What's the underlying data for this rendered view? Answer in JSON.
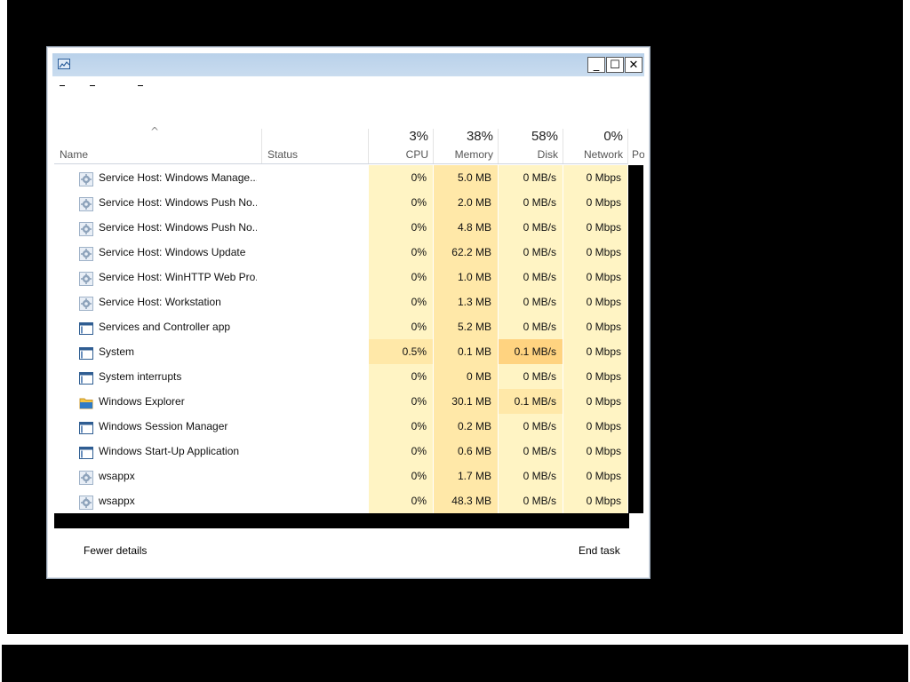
{
  "window": {
    "title": ""
  },
  "header": {
    "name_label": "Name",
    "status_label": "Status",
    "cpu": {
      "percent": "3%",
      "label": "CPU"
    },
    "memory": {
      "percent": "38%",
      "label": "Memory"
    },
    "disk": {
      "percent": "58%",
      "label": "Disk"
    },
    "network": {
      "percent": "0%",
      "label": "Network"
    },
    "power_partial": "Po",
    "sort_indicator": "^"
  },
  "colors": {
    "light_heat": "#fff4c4",
    "medium_heat": "#ffe8a8",
    "high_heat": "#ffd380"
  },
  "rows": [
    {
      "icon": "gear-icon",
      "name": "Service Host: Windows Manage...",
      "status": "",
      "cpu": "0%",
      "memory": "5.0 MB",
      "disk": "0 MB/s",
      "network": "0 Mbps"
    },
    {
      "icon": "gear-icon",
      "name": "Service Host: Windows Push No...",
      "status": "",
      "cpu": "0%",
      "memory": "2.0 MB",
      "disk": "0 MB/s",
      "network": "0 Mbps"
    },
    {
      "icon": "gear-icon",
      "name": "Service Host: Windows Push No...",
      "status": "",
      "cpu": "0%",
      "memory": "4.8 MB",
      "disk": "0 MB/s",
      "network": "0 Mbps"
    },
    {
      "icon": "gear-icon",
      "name": "Service Host: Windows Update",
      "status": "",
      "cpu": "0%",
      "memory": "62.2 MB",
      "disk": "0 MB/s",
      "network": "0 Mbps"
    },
    {
      "icon": "gear-icon",
      "name": "Service Host: WinHTTP Web Pro...",
      "status": "",
      "cpu": "0%",
      "memory": "1.0 MB",
      "disk": "0 MB/s",
      "network": "0 Mbps"
    },
    {
      "icon": "gear-icon",
      "name": "Service Host: Workstation",
      "status": "",
      "cpu": "0%",
      "memory": "1.3 MB",
      "disk": "0 MB/s",
      "network": "0 Mbps"
    },
    {
      "icon": "app-window-icon",
      "name": "Services and Controller app",
      "status": "",
      "cpu": "0%",
      "memory": "5.2 MB",
      "disk": "0 MB/s",
      "network": "0 Mbps"
    },
    {
      "icon": "app-window-icon",
      "name": "System",
      "status": "",
      "cpu": "0.5%",
      "memory": "0.1 MB",
      "disk": "0.1 MB/s",
      "network": "0 Mbps",
      "cpu_heat": "medium",
      "disk_heat": "high"
    },
    {
      "icon": "app-window-icon",
      "name": "System interrupts",
      "status": "",
      "cpu": "0%",
      "memory": "0 MB",
      "disk": "0 MB/s",
      "network": "0 Mbps"
    },
    {
      "icon": "folder-icon",
      "name": "Windows Explorer",
      "status": "",
      "cpu": "0%",
      "memory": "30.1 MB",
      "disk": "0.1 MB/s",
      "network": "0 Mbps",
      "disk_heat": "medium"
    },
    {
      "icon": "app-window-icon",
      "name": "Windows Session Manager",
      "status": "",
      "cpu": "0%",
      "memory": "0.2 MB",
      "disk": "0 MB/s",
      "network": "0 Mbps"
    },
    {
      "icon": "app-window-icon",
      "name": "Windows Start-Up Application",
      "status": "",
      "cpu": "0%",
      "memory": "0.6 MB",
      "disk": "0 MB/s",
      "network": "0 Mbps"
    },
    {
      "icon": "gear-icon",
      "name": "wsappx",
      "status": "",
      "cpu": "0%",
      "memory": "1.7 MB",
      "disk": "0 MB/s",
      "network": "0 Mbps"
    },
    {
      "icon": "gear-icon",
      "name": "wsappx",
      "status": "",
      "cpu": "0%",
      "memory": "48.3 MB",
      "disk": "0 MB/s",
      "network": "0 Mbps"
    }
  ],
  "footer": {
    "fewer_details": "Fewer details",
    "end_task": "End task"
  }
}
